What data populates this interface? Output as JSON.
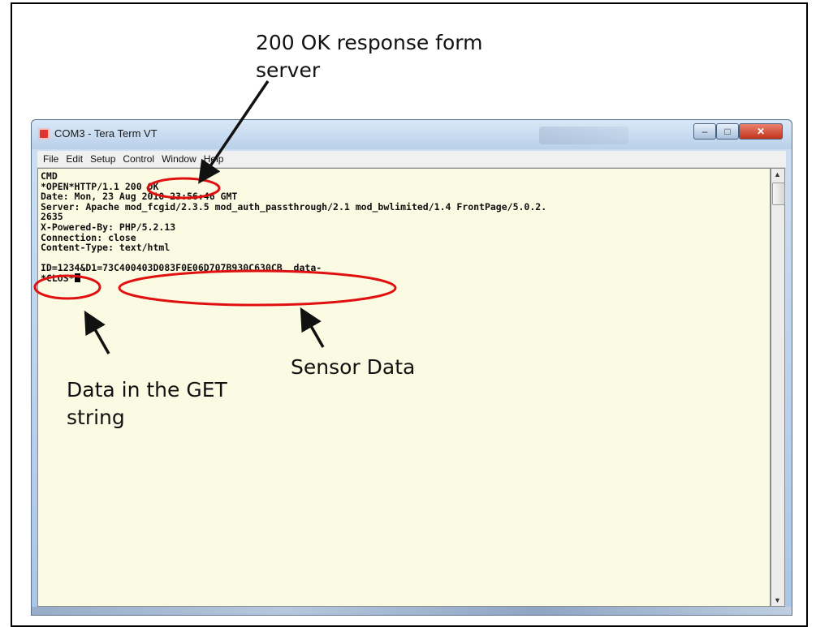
{
  "annotations": {
    "response_label_line1": "200 OK response form",
    "response_label_line2": "server",
    "sensor_label": "Sensor Data",
    "get_label_line1": "Data in the GET",
    "get_label_line2": "string"
  },
  "window": {
    "title": "COM3 - Tera Term VT",
    "menu": [
      "File",
      "Edit",
      "Setup",
      "Control",
      "Window",
      "Help"
    ]
  },
  "terminal": {
    "lines": [
      "CMD",
      "*OPEN*HTTP/1.1 200 OK",
      "Date: Mon, 23 Aug 2010 23:56:46 GMT",
      "Server: Apache mod_fcgid/2.3.5 mod_auth_passthrough/2.1 mod_bwlimited/1.4 FrontPage/5.0.2.",
      "2635",
      "X-Powered-By: PHP/5.2.13",
      "Connection: close",
      "Content-Type: text/html",
      "",
      "ID=1234&D1=73C400403D083F0E06D707B930C630CB  data-",
      "*CLOS*"
    ]
  },
  "colors": {
    "annotation_ellipse": "#e01010",
    "terminal_bg": "#fbfbe3"
  }
}
